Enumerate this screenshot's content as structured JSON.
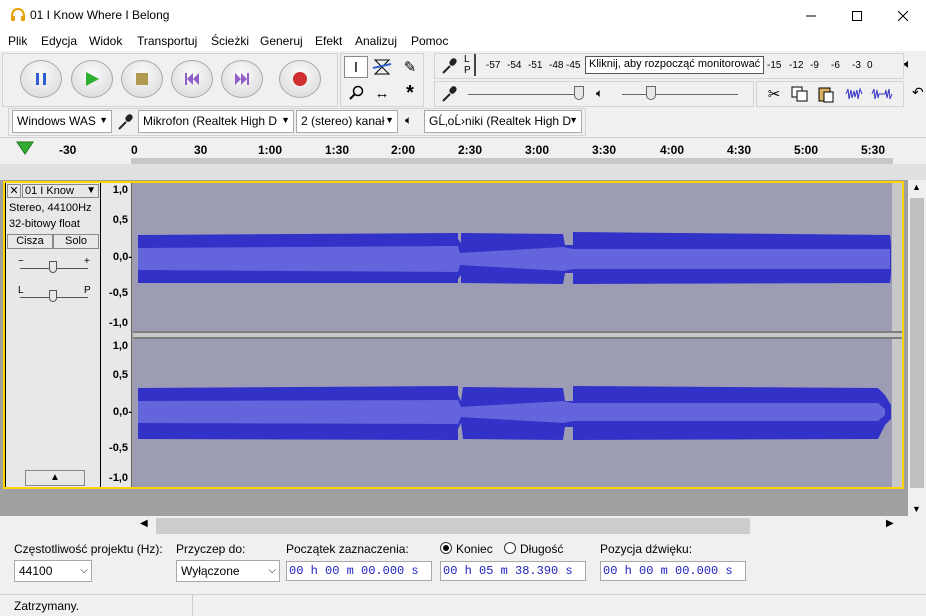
{
  "window": {
    "title": "01 I Know Where I Belong"
  },
  "menu": [
    "Plik",
    "Edycja",
    "Widok",
    "Transportuj",
    "Ścieżki",
    "Generuj",
    "Efekt",
    "Analizuj",
    "Pomoc"
  ],
  "meter": {
    "rec_labels": [
      "L",
      "P"
    ],
    "scale": [
      "-57",
      "-54",
      "-51",
      "-48",
      "-45"
    ],
    "tooltip": "Kliknij, aby rozpocząć monitorować",
    "scale_right": [
      "-15",
      "-12",
      "-9",
      "-6",
      "-3",
      "0"
    ]
  },
  "device": {
    "host": "Windows WAS",
    "input": "Mikrofon (Realtek High D",
    "channels": "2 (stereo) kanał",
    "output": "GĹ‚oĹ›niki (Realtek High D"
  },
  "ruler": {
    "ticks": [
      "-30",
      "0",
      "30",
      "1:00",
      "1:30",
      "2:00",
      "2:30",
      "3:00",
      "3:30",
      "4:00",
      "4:30",
      "5:00",
      "5:30"
    ]
  },
  "track": {
    "name": "01 I Know",
    "info1": "Stereo, 44100Hz",
    "info2": "32-bitowy float",
    "mute": "Cisza",
    "solo": "Solo",
    "gain_minus": "−",
    "gain_plus": "+",
    "pan_left": "L",
    "pan_right": "P",
    "scale": [
      "1,0",
      "0,5",
      "0,0-",
      "-0,5",
      "-1,0"
    ]
  },
  "selection": {
    "rate_label": "Częstotliwość projektu (Hz):",
    "rate_value": "44100",
    "snap_label": "Przyczep do:",
    "snap_value": "Wyłączone",
    "start_label": "Początek zaznaczenia:",
    "end_radio": "Koniec",
    "length_radio": "Długość",
    "start_value": "00 h 00 m 00.000 s",
    "end_value": "00 h 05 m 38.390 s",
    "pos_label": "Pozycja dźwięku:",
    "pos_value": "00 h 00 m 00.000 s"
  },
  "status": "Zatrzymany.",
  "colors": {
    "waveform": "#3232c8",
    "waveform_rms": "#6464dc",
    "track_bg": "#9c9cb4",
    "selection_border": "#ffd400"
  }
}
